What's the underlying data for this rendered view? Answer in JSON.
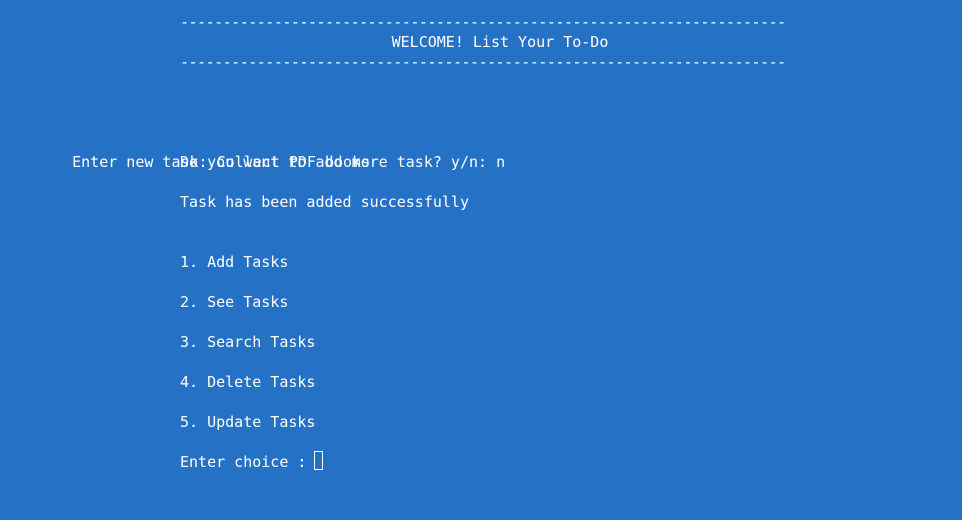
{
  "console": {
    "divider_top": "-----------------------------------------------------------------------",
    "title": "WELCOME! List Your To-Do",
    "divider_bottom": "-----------------------------------------------------------------------",
    "task_prompt": "Enter new task: ",
    "task_value": "Collect PDF books",
    "more_prompt": "Do you want to add more task? y/n: n",
    "success_message": "Task has been added successfully",
    "menu": [
      "1. Add Tasks",
      "2. See Tasks",
      "3. Search Tasks",
      "4. Delete Tasks",
      "5. Update Tasks"
    ],
    "choice_prompt": "Enter choice : "
  },
  "colors": {
    "background": "#2571c6",
    "text": "#ffffff"
  }
}
